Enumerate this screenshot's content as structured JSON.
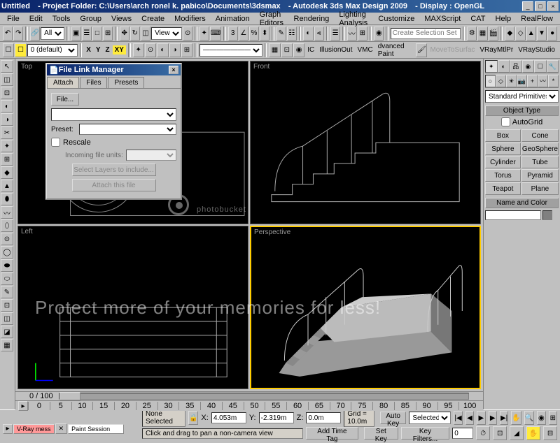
{
  "titlebar": {
    "untitled": "Untitled",
    "project": "- Project Folder: C:\\Users\\arch ronel k. pabico\\Documents\\3dsmax",
    "app": "- Autodesk 3ds Max Design 2009",
    "display": "- Display : OpenGL"
  },
  "menubar": [
    "File",
    "Edit",
    "Tools",
    "Group",
    "Views",
    "Create",
    "Modifiers",
    "Animation",
    "Graph Editors",
    "Rendering",
    "Lighting Analysis",
    "Customize",
    "MAXScript",
    "CAT",
    "Help",
    "RealFlow"
  ],
  "toolbar1": {
    "all_filter": "All",
    "view": "View",
    "selection_set_placeholder": "Create Selection Set"
  },
  "toolbar2": {
    "layer": "0 (default)",
    "axes": [
      "X",
      "Y",
      "Z",
      "XY"
    ],
    "plugins": [
      "IC",
      "IllusionOut",
      "VMC",
      "dvanced Paint",
      "MoveToSurfac",
      "VRayMtlPr",
      "VRayStudio"
    ]
  },
  "viewports": {
    "top": "Top",
    "front": "Front",
    "left": "Left",
    "perspective": "Perspective"
  },
  "dialog": {
    "title": "File Link Manager",
    "tabs": [
      "Attach",
      "Files",
      "Presets"
    ],
    "file_btn": "File...",
    "preset_label": "Preset:",
    "rescale": "Rescale",
    "incoming_units": "Incoming file units:",
    "select_btn": "Select Layers to include...",
    "attach_btn": "Attach this file"
  },
  "cmd_panel": {
    "category": "Standard Primitives",
    "object_type": "Object Type",
    "autogrid": "AutoGrid",
    "buttons": [
      "Box",
      "Cone",
      "Sphere",
      "GeoSphere",
      "Cylinder",
      "Tube",
      "Torus",
      "Pyramid",
      "Teapot",
      "Plane"
    ],
    "name_color": "Name and Color"
  },
  "timeline": {
    "frame_label": "0 / 100",
    "ticks": [
      "0",
      "5",
      "10",
      "15",
      "20",
      "25",
      "30",
      "35",
      "40",
      "45",
      "50",
      "55",
      "60",
      "65",
      "70",
      "75",
      "80",
      "85",
      "90",
      "95",
      "100"
    ]
  },
  "status": {
    "none_selected": "None Selected",
    "x_val": "4.053m",
    "y_val": "-2.319m",
    "z_val": "0.0m",
    "grid": "Grid = 10.0m",
    "auto_key": "Auto Key",
    "selected": "Selected",
    "set_key": "Set Key",
    "key_filters": "Key Filters...",
    "add_time_tag": "Add Time Tag",
    "hint": "Click and drag to pan a non-camera view",
    "vray_tab": "V-Ray mess",
    "paint_session": "Paint Session"
  },
  "watermark": {
    "logo": "photobucket",
    "tagline": "Protect more of your memories for less!"
  }
}
